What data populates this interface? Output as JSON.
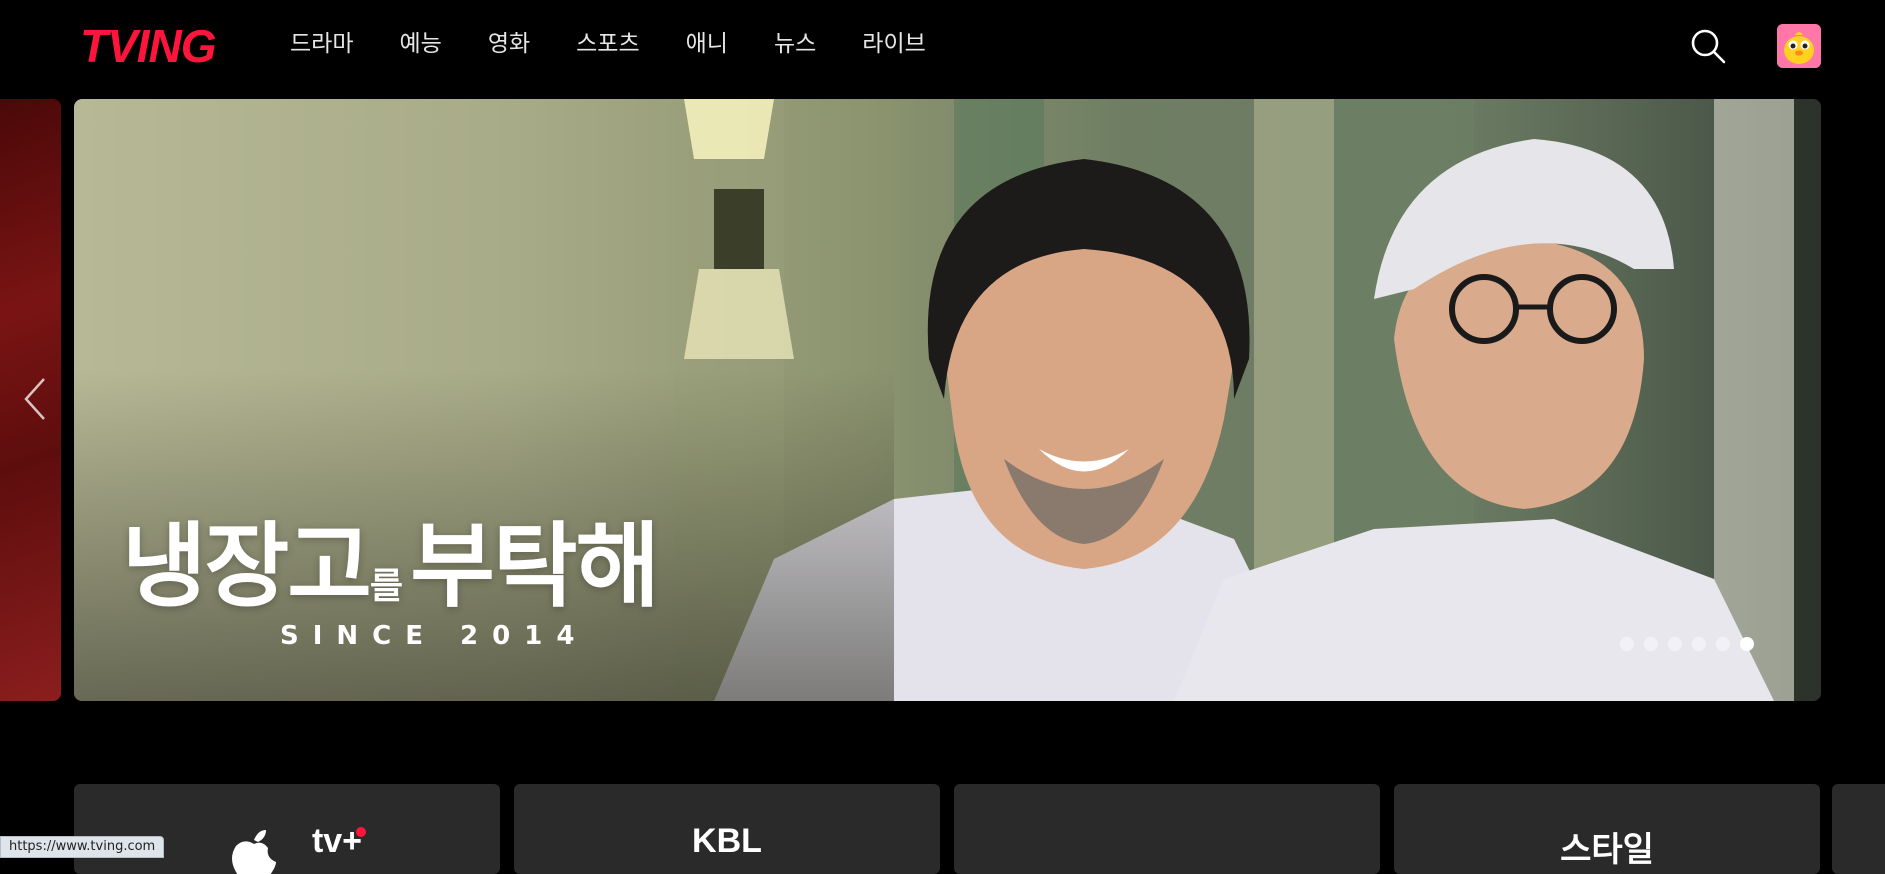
{
  "header": {
    "logo": "TVING",
    "nav": [
      "드라마",
      "예능",
      "영화",
      "스포츠",
      "애니",
      "뉴스",
      "라이브"
    ],
    "search_icon": "search-icon",
    "avatar_icon": "profile-avatar"
  },
  "hero": {
    "title_main": "냉장고",
    "title_small": "를",
    "title_end": "부탁해",
    "subtitle": "SINCE 2014",
    "slide_count": 6,
    "active_slide": 6
  },
  "channels": [
    "tv+",
    "KBL",
    "",
    "스타일"
  ],
  "status_bar": {
    "url": "https://www.tving.com"
  },
  "colors": {
    "brand": "#ff153c",
    "background": "#000000",
    "card": "#2a2a2a"
  }
}
